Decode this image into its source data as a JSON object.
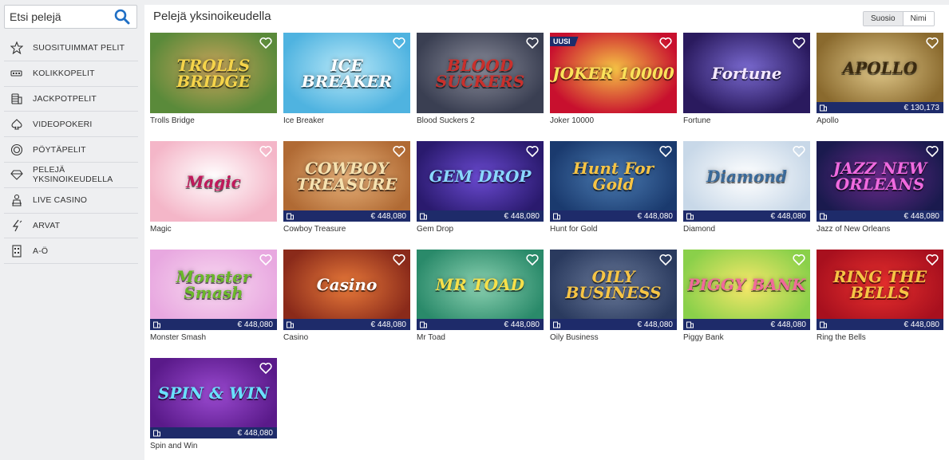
{
  "search": {
    "placeholder": "Etsi pelejä"
  },
  "sidebar": {
    "items": [
      {
        "label": "SUOSITUIMMAT PELIT",
        "icon": "star-icon"
      },
      {
        "label": "KOLIKKOPELIT",
        "icon": "slot-machine-icon"
      },
      {
        "label": "JACKPOTPELIT",
        "icon": "coins-icon"
      },
      {
        "label": "VIDEOPOKERI",
        "icon": "spade-icon"
      },
      {
        "label": "PÖYTÄPELIT",
        "icon": "chip-icon"
      },
      {
        "label": "PELEJÄ YKSINOIKEUDELLA",
        "icon": "diamond-icon"
      },
      {
        "label": "LIVE CASINO",
        "icon": "dealer-icon"
      },
      {
        "label": "ARVAT",
        "icon": "lottery-icon"
      },
      {
        "label": "A-Ö",
        "icon": "alphabet-icon"
      }
    ]
  },
  "main": {
    "title": "Pelejä yksinoikeudella",
    "sort": {
      "active": "Suosio",
      "inactive": "Nimi"
    }
  },
  "badges": {
    "new": "UUSI"
  },
  "games": [
    {
      "name": "Trolls Bridge",
      "art": "TROLLS BRIDGE",
      "jackpot": "",
      "new": false,
      "bg": "#5a8a3a",
      "bg2": "#c9a35a",
      "fg": "#f5d44a"
    },
    {
      "name": "Ice Breaker",
      "art": "ICE BREAKER",
      "jackpot": "",
      "new": false,
      "bg": "#4fb3e0",
      "bg2": "#b8e8f8",
      "fg": "#ffffff"
    },
    {
      "name": "Blood Suckers 2",
      "art": "BLOOD SUCKERS",
      "jackpot": "",
      "new": false,
      "bg": "#3a3f52",
      "bg2": "#8a8c9a",
      "fg": "#c9302c"
    },
    {
      "name": "Joker 10000",
      "art": "JOKER 10000",
      "jackpot": "",
      "new": true,
      "bg": "#c8102e",
      "bg2": "#f6c445",
      "fg": "#fbe15a"
    },
    {
      "name": "Fortune",
      "art": "Fortune",
      "jackpot": "",
      "new": false,
      "bg": "#2a1a5e",
      "bg2": "#7a6ad0",
      "fg": "#f4e8ff"
    },
    {
      "name": "Apollo",
      "art": "APOLLO",
      "jackpot": "€ 130,173",
      "new": false,
      "bg": "#8a6a2e",
      "bg2": "#e0c88a",
      "fg": "#3a2a10"
    },
    {
      "name": "Magic",
      "art": "Magic",
      "jackpot": "",
      "new": false,
      "bg": "#f4b6c8",
      "bg2": "#ffffff",
      "fg": "#c2185b"
    },
    {
      "name": "Cowboy Treasure",
      "art": "COWBOY TREASURE",
      "jackpot": "€ 448,080",
      "new": false,
      "bg": "#b06a34",
      "bg2": "#e8b27a",
      "fg": "#f6e2b0"
    },
    {
      "name": "Gem Drop",
      "art": "GEM DROP",
      "jackpot": "€ 448,080",
      "new": false,
      "bg": "#2a1a6e",
      "bg2": "#6a4ad0",
      "fg": "#8ad8ff"
    },
    {
      "name": "Hunt for Gold",
      "art": "Hunt For Gold",
      "jackpot": "€ 448,080",
      "new": false,
      "bg": "#1a3a6e",
      "bg2": "#4a7ab0",
      "fg": "#f6c445"
    },
    {
      "name": "Diamond",
      "art": "Diamond",
      "jackpot": "€ 448,080",
      "new": false,
      "bg": "#c8d8e8",
      "bg2": "#ffffff",
      "fg": "#3a6a9a"
    },
    {
      "name": "Jazz of New Orleans",
      "art": "JAZZ NEW ORLEANS",
      "jackpot": "€ 448,080",
      "new": false,
      "bg": "#1a1a4e",
      "bg2": "#6a2a8a",
      "fg": "#f06adf"
    },
    {
      "name": "Monster Smash",
      "art": "Monster Smash",
      "jackpot": "€ 448,080",
      "new": false,
      "bg": "#e8a8e0",
      "bg2": "#f8d8f0",
      "fg": "#6ab82a"
    },
    {
      "name": "Casino",
      "art": "Casino",
      "jackpot": "€ 448,080",
      "new": false,
      "bg": "#8a2a1a",
      "bg2": "#e87a3a",
      "fg": "#ffffff"
    },
    {
      "name": "Mr Toad",
      "art": "MR TOAD",
      "jackpot": "€ 448,080",
      "new": false,
      "bg": "#2a8a6a",
      "bg2": "#8ad0b0",
      "fg": "#f6e04a"
    },
    {
      "name": "Oily Business",
      "art": "OILY BUSINESS",
      "jackpot": "€ 448,080",
      "new": false,
      "bg": "#2a3a5e",
      "bg2": "#6a7a9a",
      "fg": "#f6c445"
    },
    {
      "name": "Piggy Bank",
      "art": "PIGGY BANK",
      "jackpot": "€ 448,080",
      "new": false,
      "bg": "#8ad04a",
      "bg2": "#f8e86a",
      "fg": "#f06a9a"
    },
    {
      "name": "Ring the Bells",
      "art": "RING THE BELLS",
      "jackpot": "€ 448,080",
      "new": false,
      "bg": "#a8101e",
      "bg2": "#e8302e",
      "fg": "#f6c445"
    },
    {
      "name": "Spin and Win",
      "art": "SPIN & WIN",
      "jackpot": "€ 448,080",
      "new": false,
      "bg": "#5a1a8a",
      "bg2": "#9a4ad0",
      "fg": "#6ae0ff"
    }
  ]
}
